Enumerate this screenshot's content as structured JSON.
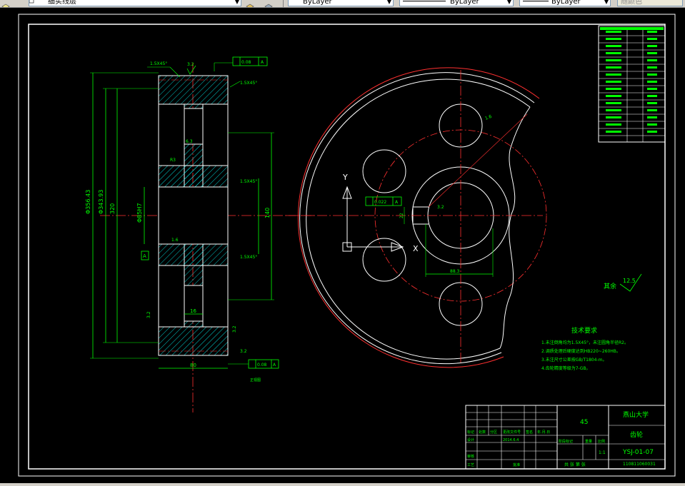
{
  "toolbar": {
    "layer_name": "细实线层",
    "color_value": "ByLayer",
    "linetype_value": "ByLayer",
    "lineweight_value": "ByLayer",
    "plotstyle_value": "随颜色"
  },
  "drawing": {
    "tech_req_title": "技术要求",
    "tech_req_items": [
      "1.未注倒角均为1.5X45°，未注圆角半径R2。",
      "2.调质处理后硬度达到HB220~260HB。",
      "3.未注尺寸公差按GB/T1804-m。",
      "4.齿轮精度等级为7-GB。"
    ],
    "surface_label": "其余",
    "surface_value": "12.5",
    "material": "45",
    "school": "燕山大学",
    "part_name": "齿轮",
    "drawing_number": "YSJ-01-07",
    "student_id": "110811060031",
    "scale": "1:1",
    "col_labels": [
      "标记",
      "处数",
      "分区",
      "更改文件号",
      "签名",
      "年.月.日"
    ],
    "row_labels": [
      "设计",
      "审核",
      "工艺",
      "批准"
    ],
    "design_date": "2014.6.4",
    "stage_labels": [
      "阶段标记",
      "重量",
      "比例"
    ],
    "sheet_label": "共 张 第 张",
    "dim_texts": {
      "chamfer_top": "1.5X45°",
      "chamfer_mid": "1.5X45°",
      "chamfer_low": "1.5X45°",
      "runout_top": "0.08",
      "runout_bottom": "0.08",
      "datum": "A",
      "tolerance_key": "0.022",
      "dia_outer": "Φ356.43",
      "dia_root": "Φ343.93",
      "dia_rim": "320",
      "dia_hub": "Φ85H7",
      "dim_width_bottom": "80",
      "dim_web": "16",
      "dim_bore_right": "140",
      "rough_a": "3.2",
      "rough_b": "1.6",
      "rough_c": "6.3",
      "key_dim": "88.3",
      "slot_width": "22",
      "axis_x": "X",
      "axis_y": "Y",
      "label_zhengmian": "正视图",
      "r_label": "R3"
    }
  }
}
